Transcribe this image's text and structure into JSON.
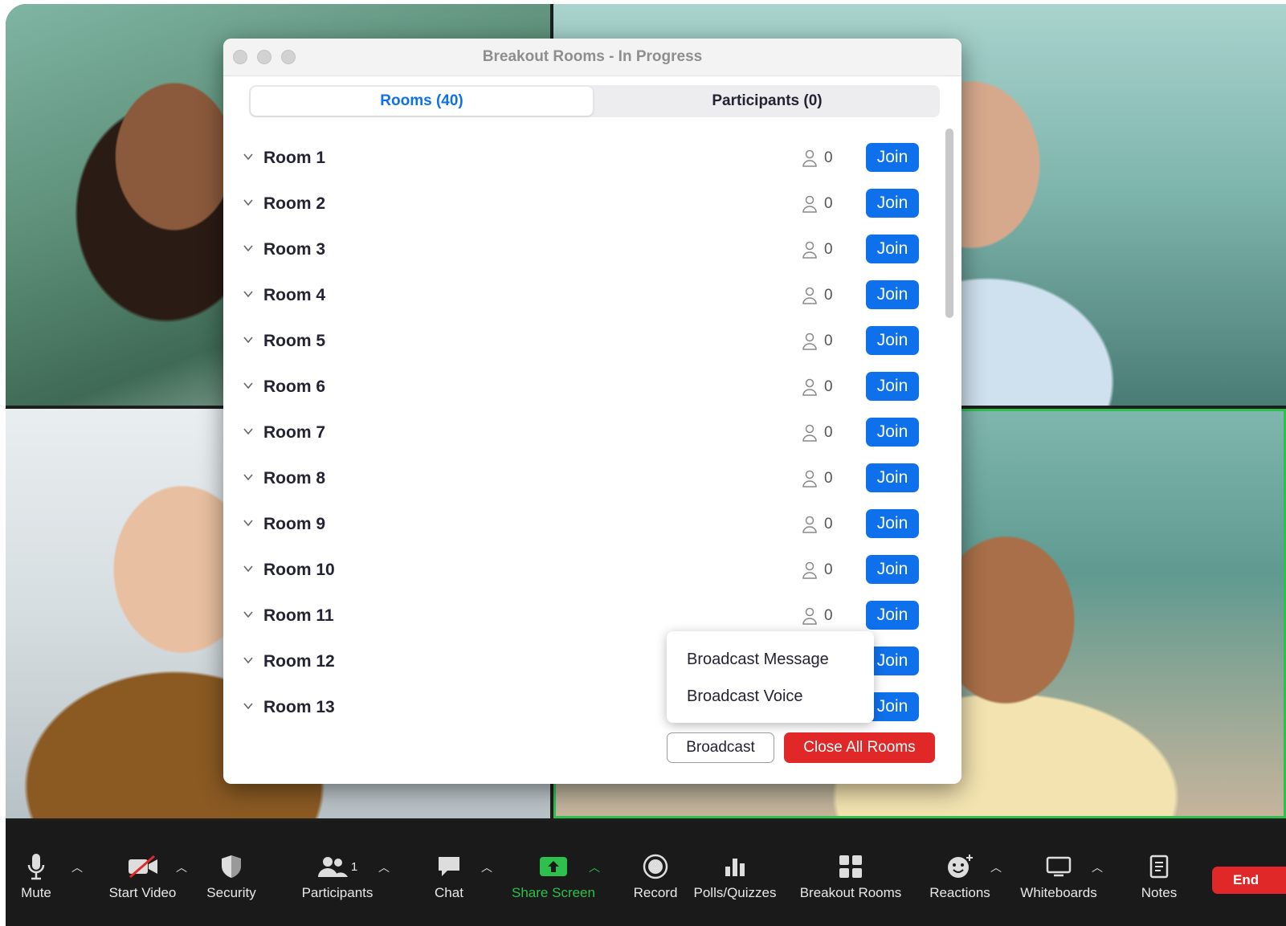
{
  "dialog": {
    "title": "Breakout Rooms - In Progress",
    "tabs": [
      {
        "label": "Rooms (40)",
        "active": true
      },
      {
        "label": "Participants (0)",
        "active": false
      }
    ],
    "rooms": [
      {
        "name": "Room 1",
        "count": "0",
        "join": "Join"
      },
      {
        "name": "Room 2",
        "count": "0",
        "join": "Join"
      },
      {
        "name": "Room 3",
        "count": "0",
        "join": "Join"
      },
      {
        "name": "Room 4",
        "count": "0",
        "join": "Join"
      },
      {
        "name": "Room 5",
        "count": "0",
        "join": "Join"
      },
      {
        "name": "Room 6",
        "count": "0",
        "join": "Join"
      },
      {
        "name": "Room 7",
        "count": "0",
        "join": "Join"
      },
      {
        "name": "Room 8",
        "count": "0",
        "join": "Join"
      },
      {
        "name": "Room 9",
        "count": "0",
        "join": "Join"
      },
      {
        "name": "Room 10",
        "count": "0",
        "join": "Join"
      },
      {
        "name": "Room 11",
        "count": "0",
        "join": "Join"
      },
      {
        "name": "Room 12",
        "count": "",
        "join": "Join"
      },
      {
        "name": "Room 13",
        "count": "",
        "join": "Join"
      }
    ],
    "broadcast_menu": [
      "Broadcast Message",
      "Broadcast Voice"
    ],
    "broadcast_label": "Broadcast",
    "close_all_label": "Close All Rooms"
  },
  "toolbar": {
    "mute": "Mute",
    "start_video": "Start Video",
    "security": "Security",
    "participants": "Participants",
    "participants_count": "1",
    "chat": "Chat",
    "share_screen": "Share Screen",
    "record": "Record",
    "polls": "Polls/Quizzes",
    "breakout_rooms": "Breakout Rooms",
    "reactions": "Reactions",
    "whiteboards": "Whiteboards",
    "notes": "Notes",
    "end": "End"
  },
  "colors": {
    "accent": "#0e71eb",
    "danger": "#e02828",
    "share_green": "#2ec04c"
  }
}
